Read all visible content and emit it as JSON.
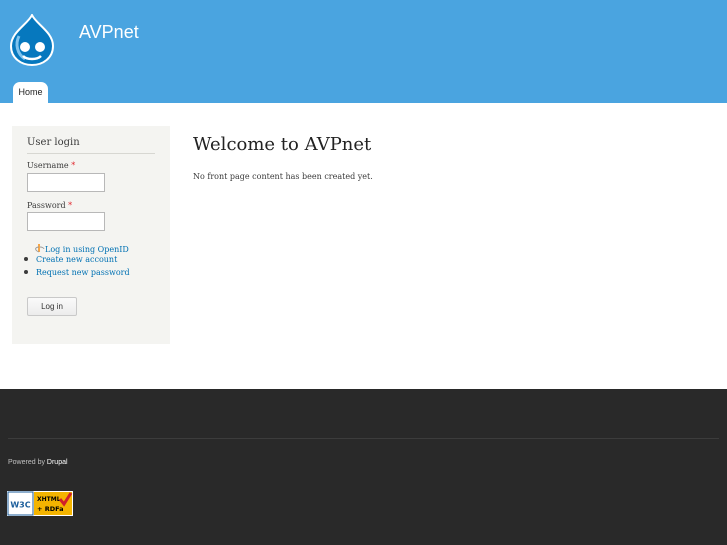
{
  "header": {
    "site_name": "AVPnet",
    "logo_icon": "drupal-drop-logo",
    "tabs": [
      {
        "label": "Home",
        "active": true
      }
    ]
  },
  "sidebar": {
    "block_title": "User login",
    "username_label": "Username",
    "username_value": "",
    "password_label": "Password",
    "password_value": "",
    "required_marker": "*",
    "openid_link": "Log in using OpenID",
    "links": [
      "Create new account",
      "Request new password"
    ],
    "login_button": "Log in"
  },
  "main": {
    "title": "Welcome to AVPnet",
    "body": "No front page content has been created yet."
  },
  "footer": {
    "powered_prefix": "Powered by",
    "powered_link": "Drupal",
    "badge": {
      "top_line": "XHTML",
      "bottom_line": "+ RDFa",
      "brand": "W3C"
    }
  },
  "colors": {
    "header_bg": "#4aa4e0",
    "link": "#0071b3",
    "footer_bg": "#292929",
    "required": "#e0252b"
  }
}
